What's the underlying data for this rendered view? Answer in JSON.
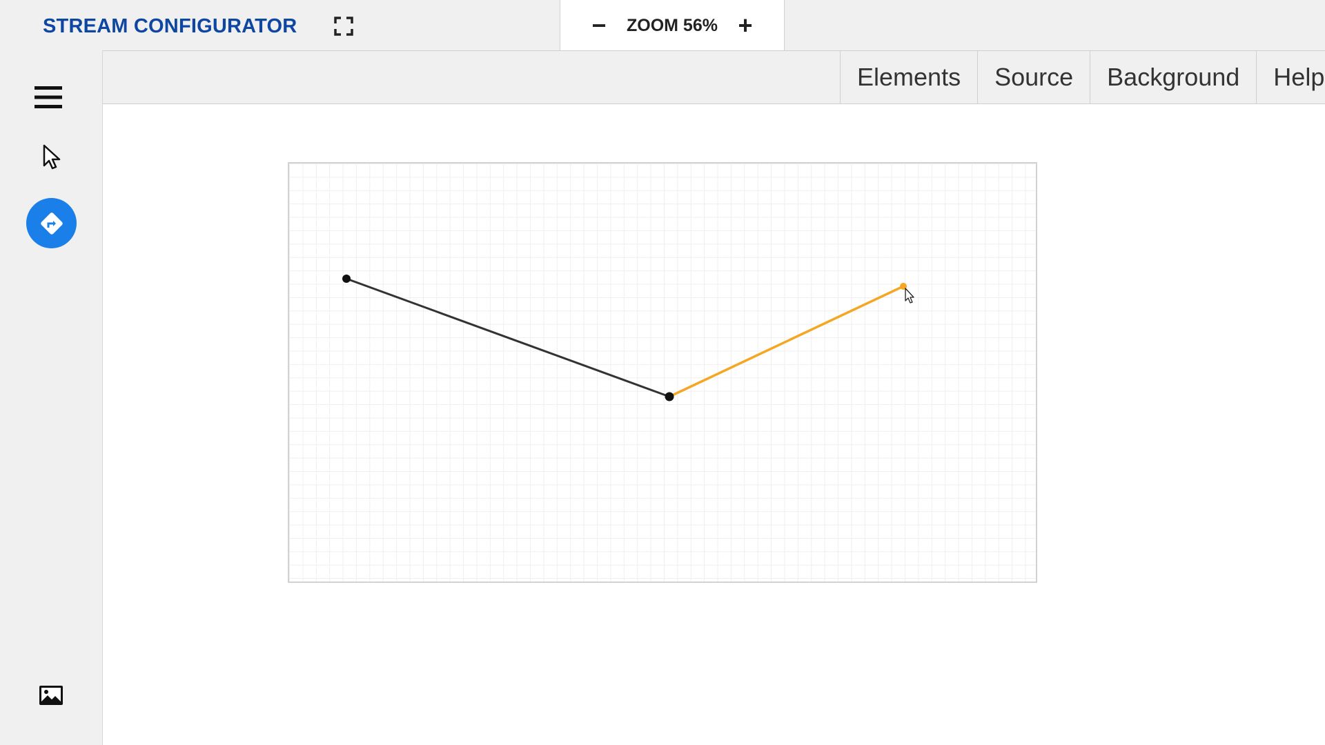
{
  "header": {
    "title": "STREAM CONFIGURATOR",
    "fullscreen_icon": "fullscreen-icon"
  },
  "zoom": {
    "label": "ZOOM 56%",
    "minus": "−",
    "plus": "+"
  },
  "toolbar": {
    "tools": [
      "menu-icon",
      "pointer-icon",
      "route-icon",
      "image-icon"
    ],
    "active_color": "#1a7fe8"
  },
  "menu": {
    "tabs": [
      "Elements",
      "Source",
      "Background",
      "Help"
    ]
  },
  "canvas": {
    "line_color": "#333333",
    "active_line_color": "#f5a623"
  }
}
